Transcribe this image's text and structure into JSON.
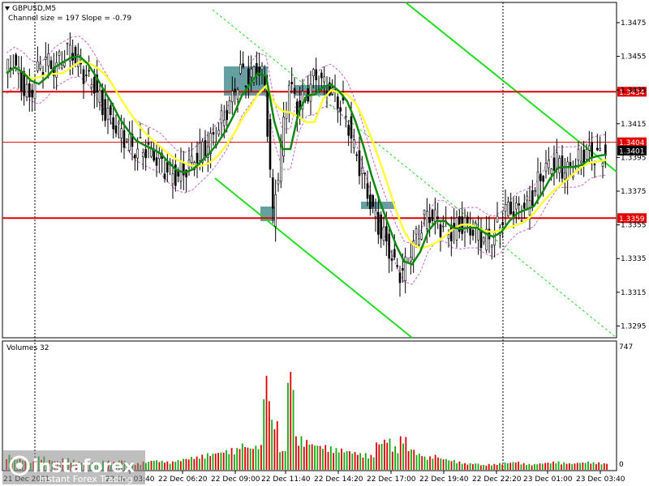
{
  "header": {
    "symbol": "GBPUSD,M5",
    "subtitle": "Channel size = 197 Slope = -0.79"
  },
  "volume_panel": {
    "title": "Volumes 32",
    "max_label": "747",
    "zero_label": "0"
  },
  "watermark": {
    "brand": "instaforex",
    "tagline": "Instant Forex Trading"
  },
  "colors": {
    "support_resistance": "#e00000",
    "channel": "#22dd22",
    "ma_fast": "#ffff33",
    "ma_slow": "#118811",
    "candle": "#000000",
    "zone": "#4a8f8f",
    "envelope": "#cc66cc",
    "volume_up": "#11aa11",
    "volume_down": "#dd0000"
  },
  "chart_data": {
    "type": "candlestick",
    "symbol": "GBPUSD",
    "timeframe": "M5",
    "y_ticks": [
      1.3475,
      1.3455,
      1.3435,
      1.3415,
      1.3395,
      1.3375,
      1.3355,
      1.3335,
      1.3315,
      1.3295
    ],
    "ylim": [
      1.3288,
      1.3487
    ],
    "x_ticks": [
      "22 Dec 03:40",
      "22 Dec 06:20",
      "22 Dec 09:00",
      "22 Dec 11:40",
      "22 Dec 14:20",
      "22 Dec 17:00",
      "22 Dec 19:40",
      "22 Dec 22:20",
      "23 Dec 01:00",
      "23 Dec 03:40"
    ],
    "x_prefix_label": "21 Dec 2021",
    "price_levels": [
      {
        "value": 1.3434,
        "label": "1.3434"
      },
      {
        "value": 1.3359,
        "label": "1.3359"
      },
      {
        "value": 1.3404,
        "label": "1.3404"
      }
    ],
    "current_price": {
      "value": 1.3401,
      "label": "1.3401"
    },
    "close_series": [
      1.3445,
      1.3452,
      1.344,
      1.343,
      1.3446,
      1.3452,
      1.3448,
      1.3455,
      1.346,
      1.345,
      1.3442,
      1.3438,
      1.3425,
      1.3418,
      1.341,
      1.3405,
      1.34,
      1.3402,
      1.3398,
      1.3392,
      1.3386,
      1.3384,
      1.3388,
      1.3392,
      1.3398,
      1.3402,
      1.341,
      1.342,
      1.343,
      1.3445,
      1.344,
      1.345,
      1.344,
      1.336,
      1.34,
      1.344,
      1.3425,
      1.343,
      1.3442,
      1.3438,
      1.3435,
      1.343,
      1.342,
      1.34,
      1.3385,
      1.3368,
      1.3355,
      1.3345,
      1.333,
      1.3325,
      1.334,
      1.3352,
      1.3362,
      1.3358,
      1.3352,
      1.335,
      1.3356,
      1.3354,
      1.335,
      1.3346,
      1.3348,
      1.3358,
      1.3366,
      1.3362,
      1.3364,
      1.3372,
      1.3385,
      1.339,
      1.3392,
      1.3386,
      1.339,
      1.3396,
      1.3398,
      1.3394,
      1.3398
    ],
    "volume_series": [
      90,
      70,
      60,
      50,
      80,
      60,
      55,
      70,
      60,
      50,
      45,
      40,
      55,
      50,
      60,
      45,
      40,
      50,
      60,
      55,
      50,
      60,
      70,
      80,
      90,
      100,
      110,
      120,
      130,
      160,
      140,
      150,
      560,
      300,
      120,
      600,
      200,
      180,
      160,
      150,
      140,
      130,
      120,
      110,
      100,
      90,
      170,
      190,
      140,
      200,
      130,
      100,
      80,
      90,
      70,
      60,
      50,
      40,
      40,
      30,
      35,
      40,
      45,
      50,
      40,
      35,
      40,
      45,
      50,
      45,
      40,
      45,
      50,
      45,
      40
    ],
    "volume_ylim": [
      0,
      747
    ],
    "indicators": [
      "moving average (yellow)",
      "moving average (green)",
      "envelope (purple)",
      "regression channel (green)"
    ],
    "grid": false
  }
}
